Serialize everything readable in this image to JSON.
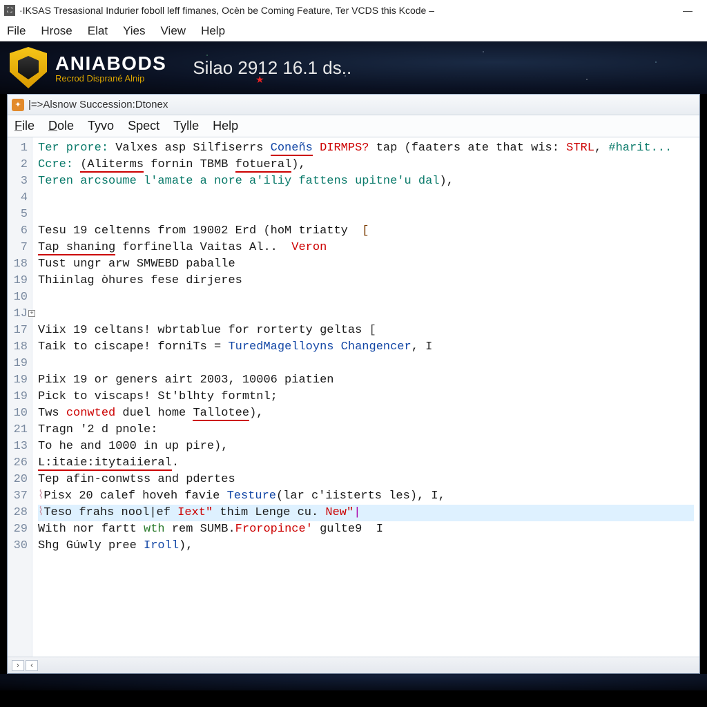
{
  "outer_window": {
    "title": "·IKSAS Tresasional Indurier foboll leff fimanes, Ocèn be Coming Feature, Ter VCDS this Kcode  –",
    "buttons": {
      "minimize": "—"
    }
  },
  "outer_menu": [
    "File",
    "Hrose",
    "Elat",
    "Yies",
    "View",
    "Help"
  ],
  "banner": {
    "brand": "ANIABODS",
    "subtitle": "Recrod Disprané Alnip",
    "title": "Silao 2912 16.1 ds..",
    "star": "★"
  },
  "doc_tab": {
    "label": "|=>Alsnow Succession:Dtonex"
  },
  "doc_menu": [
    {
      "label": "File",
      "u": "F"
    },
    {
      "label": "Dole",
      "u": "D"
    },
    {
      "label": "Tyvo",
      "u": ""
    },
    {
      "label": "Spect",
      "u": ""
    },
    {
      "label": "Tylle",
      "u": ""
    },
    {
      "label": "Help",
      "u": ""
    }
  ],
  "gutter_numbers": [
    "1",
    "2",
    "3",
    "4",
    "5",
    "6",
    "7",
    "18",
    "19",
    "10",
    "1J",
    "17",
    "18",
    "19",
    "19",
    "19",
    "10",
    "21",
    "13",
    "26",
    "20",
    "37",
    "28",
    "29",
    "30"
  ],
  "code_lines": [
    {
      "segments": [
        {
          "t": "Ter prore: ",
          "c": "kw-teal"
        },
        {
          "t": "Valxes asp Silfiserrs ",
          "c": ""
        },
        {
          "t": "Coneñs",
          "c": "kw-blue ul-red"
        },
        {
          "t": " "
        },
        {
          "t": "DIRMPS?",
          "c": "kw-red"
        },
        {
          "t": " tap (faaters ate that wis: "
        },
        {
          "t": "STRL",
          "c": "kw-red"
        },
        {
          "t": ", "
        },
        {
          "t": "#harit...",
          "c": "kw-teal"
        }
      ]
    },
    {
      "segments": [
        {
          "t": "Ccre: ",
          "c": "kw-teal"
        },
        {
          "t": "(Aliterms",
          "c": "ul-red"
        },
        {
          "t": " fornin TBMB "
        },
        {
          "t": "fotueral",
          "c": "ul-red"
        },
        {
          "t": "),"
        }
      ]
    },
    {
      "segments": [
        {
          "t": "Teren arcsoume l'amate a nore a'iliy fattens upitne'u dal",
          "c": "kw-teal"
        },
        {
          "t": "),"
        }
      ]
    },
    {
      "segments": [
        {
          "t": ""
        }
      ]
    },
    {
      "segments": [
        {
          "t": ""
        }
      ]
    },
    {
      "segments": [
        {
          "t": "Tesu 19 celtenns from 19002 Erd (hoM triatty  "
        },
        {
          "t": "[",
          "c": "kw-brown"
        }
      ]
    },
    {
      "segments": [
        {
          "t": "Tap shaning",
          "c": "ul-red"
        },
        {
          "t": " forfinella Vaitas Al..  "
        },
        {
          "t": "Veron",
          "c": "kw-red"
        }
      ]
    },
    {
      "segments": [
        {
          "t": "Tust ungr arw SMWEBD paballe"
        }
      ]
    },
    {
      "segments": [
        {
          "t": "Thiinlag òhures fese dirjeres"
        }
      ]
    },
    {
      "segments": [
        {
          "t": ""
        }
      ]
    },
    {
      "segments": [
        {
          "t": ""
        }
      ],
      "fold": true
    },
    {
      "segments": [
        {
          "t": "Viix 19 celtans! wbrtablue for rorterty geltas "
        },
        {
          "t": "[",
          "c": "punct"
        }
      ]
    },
    {
      "segments": [
        {
          "t": "Taik to ciscape! forniTs = "
        },
        {
          "t": "TuredMagelloyns Changencer",
          "c": "kw-blue"
        },
        {
          "t": ", I"
        }
      ]
    },
    {
      "segments": [
        {
          "t": ""
        }
      ]
    },
    {
      "segments": [
        {
          "t": "Piix 19 or geners airt 2003, 10006 piatien"
        }
      ]
    },
    {
      "segments": [
        {
          "t": "Pick to viscaps! St'blhty formtnl;"
        }
      ]
    },
    {
      "segments": [
        {
          "t": "Tws "
        },
        {
          "t": "conwted",
          "c": "kw-red"
        },
        {
          "t": " duel home "
        },
        {
          "t": "Tallotee",
          "c": "ul-red"
        },
        {
          "t": "),"
        }
      ]
    },
    {
      "segments": [
        {
          "t": "Tragn '2 d pnole:"
        }
      ]
    },
    {
      "segments": [
        {
          "t": "To he and 1000 in up pire),"
        }
      ]
    },
    {
      "segments": [
        {
          "t": "L:itaie:itytaiieral",
          "c": "ul-red"
        },
        {
          "t": "."
        }
      ]
    },
    {
      "segments": [
        {
          "t": "Tep afin-conwtss and pdertes"
        }
      ]
    },
    {
      "segments": [
        {
          "t": "Pisx 20 calef hoveh favie "
        },
        {
          "t": "Testure",
          "c": "kw-blue"
        },
        {
          "t": "(lar c'iisterts les), I,"
        }
      ],
      "prefix_icon": true
    },
    {
      "segments": [
        {
          "t": "Teso frahs nool|ef "
        },
        {
          "t": "Iext\"",
          "c": "kw-red"
        },
        {
          "t": " thim Lenge cu. "
        },
        {
          "t": "New\"",
          "c": "kw-red"
        },
        {
          "t": "|",
          "c": "caret-mark"
        }
      ],
      "highlight": true,
      "prefix_icon": true
    },
    {
      "segments": [
        {
          "t": "With nor fartt "
        },
        {
          "t": "wth",
          "c": "kw-green"
        },
        {
          "t": " rem SUMB."
        },
        {
          "t": "Froropince'",
          "c": "kw-red"
        },
        {
          "t": " gulte9  I"
        }
      ]
    },
    {
      "segments": [
        {
          "t": "Shg Gúwly pree "
        },
        {
          "t": "Iroll",
          "c": "kw-blue"
        },
        {
          "t": "),"
        }
      ]
    }
  ],
  "statusbar": {
    "left_chevron": "›",
    "right_chevron": "‹"
  }
}
